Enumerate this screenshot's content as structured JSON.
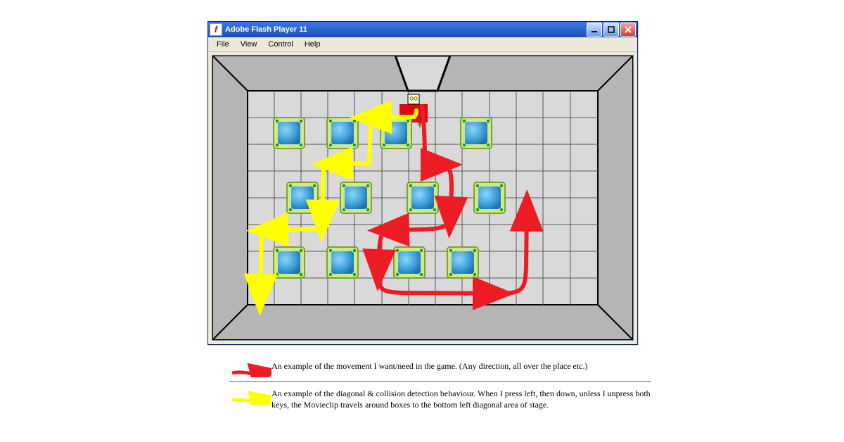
{
  "window": {
    "title": "Adobe Flash Player 11",
    "app_icon_glyph": "f"
  },
  "menu": {
    "file": "File",
    "view": "View",
    "control": "Control",
    "help": "Help"
  },
  "legend": {
    "red": "An example of the movement I want/need in the game. (Any direction, all over the place etc.)",
    "yellow": "An example of the diagonal & collision detection behaviour. When I press left, then down, unless I unpress both keys, the Movieclip travels around boxes to the bottom left diagonal area of stage."
  },
  "colors": {
    "path_red": "#ed1c24",
    "path_yellow": "#ffff00",
    "tile_blue1": "#2b8fcf",
    "tile_blue2": "#6dc6f2",
    "tile_border": "#b9e86c",
    "dot": "#159a1a",
    "wall": "#666666",
    "grid": "#222222",
    "floor": "#d9d9d9"
  }
}
